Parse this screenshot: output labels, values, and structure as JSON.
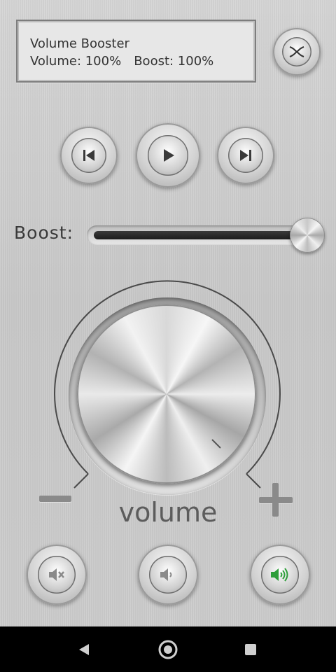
{
  "display": {
    "app_title": "Volume Booster",
    "volume_text": "Volume: 100%",
    "boost_text": "Boost: 100%"
  },
  "controls": {
    "previous_icon": "skip-previous-icon",
    "play_icon": "play-icon",
    "next_icon": "skip-next-icon",
    "eq_icon": "equalizer-icon"
  },
  "boost": {
    "label": "Boost:",
    "level": 1.0
  },
  "knob": {
    "label": "volume",
    "level": 1.0
  },
  "presets": [
    {
      "icon": "mute-icon"
    },
    {
      "icon": "volume-low-icon"
    },
    {
      "icon": "volume-high-icon",
      "active": true
    }
  ],
  "colors": {
    "active_speaker": "#2e9e3a",
    "inactive_icon": "#8a8a8a"
  },
  "navbar": {
    "back_icon": "back-triangle-icon",
    "home_icon": "home-circle-icon",
    "recents_icon": "recents-square-icon"
  }
}
